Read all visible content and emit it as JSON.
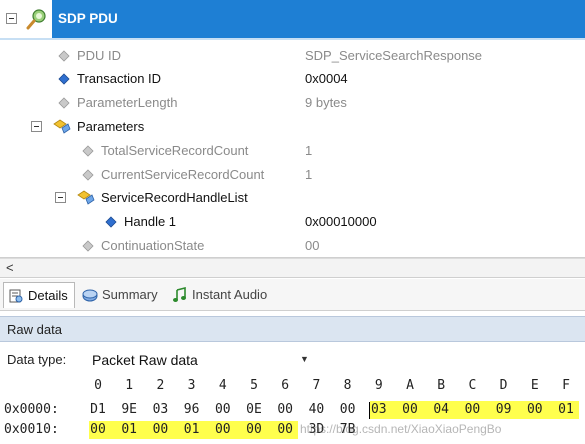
{
  "tree": {
    "title": "SDP PDU",
    "rows": [
      {
        "name": "PDU ID",
        "value": "SDP_ServiceSearchResponse"
      },
      {
        "name": "Transaction ID",
        "value": "0x0004"
      },
      {
        "name": "ParameterLength",
        "value": "9 bytes"
      },
      {
        "name": "Parameters",
        "value": ""
      },
      {
        "name": "TotalServiceRecordCount",
        "value": "1"
      },
      {
        "name": "CurrentServiceRecordCount",
        "value": "1"
      },
      {
        "name": "ServiceRecordHandleList",
        "value": ""
      },
      {
        "name": "Handle 1",
        "value": "0x00010000"
      },
      {
        "name": "ContinuationState",
        "value": "00"
      }
    ],
    "scroll_arrow": "<"
  },
  "tabs": [
    {
      "label": "Details",
      "icon": "details-icon"
    },
    {
      "label": "Summary",
      "icon": "summary-icon"
    },
    {
      "label": "Instant Audio",
      "icon": "music-note-icon"
    }
  ],
  "raw_data": {
    "header": "Raw data",
    "data_type_label": "Data type:",
    "data_type_value": "Packet Raw data",
    "columns": [
      "0",
      "1",
      "2",
      "3",
      "4",
      "5",
      "6",
      "7",
      "8",
      "9",
      "A",
      "B",
      "C",
      "D",
      "E",
      "F"
    ],
    "rows": [
      {
        "address": "0x0000:",
        "bytes": [
          "D1",
          "9E",
          "03",
          "96",
          "00",
          "0E",
          "00",
          "40",
          "00",
          "03",
          "00",
          "04",
          "00",
          "09",
          "00",
          "01"
        ]
      },
      {
        "address": "0x0010:",
        "bytes": [
          "00",
          "01",
          "00",
          "01",
          "00",
          "00",
          "00",
          "3D",
          "7B"
        ]
      }
    ]
  },
  "watermark": "https://blog.csdn.net/XiaoXiaoPengBo",
  "colors": {
    "title_bar": "#1e7fd4",
    "raw_header": "#dbe5f1",
    "highlight": "#ffff4d"
  }
}
